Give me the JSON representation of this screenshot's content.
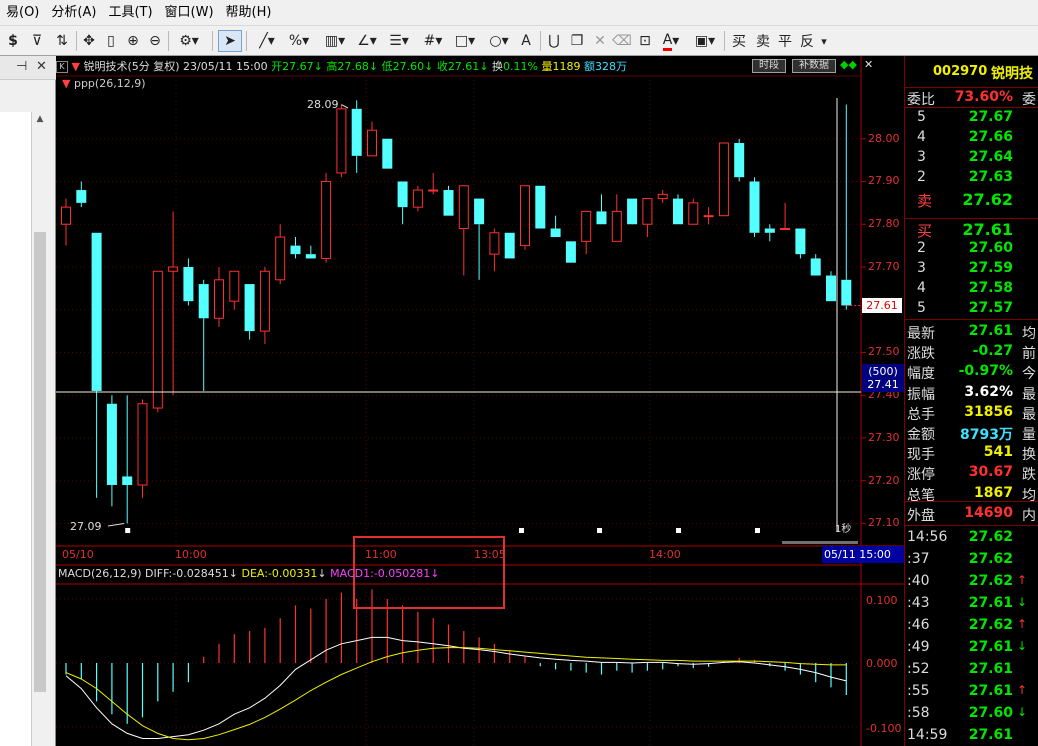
{
  "menu": [
    "易(O)",
    "分析(A)",
    "工具(T)",
    "窗口(W)",
    "帮助(H)"
  ],
  "toolbar": {
    "dollar": "$",
    "buy": "买",
    "sell": "卖",
    "flat": "平",
    "reverse": "反"
  },
  "chart_header": {
    "name": "锐明技术(5分 复权)",
    "datetime": "23/05/11 15:00",
    "open_label": "开",
    "open": "27.67",
    "high_label": "高",
    "high": "27.68",
    "low_label": "低",
    "low": "27.60",
    "close_label": "收",
    "close": "27.61",
    "turnover_label": "换",
    "turnover": "0.11%",
    "volume_label": "量",
    "volume": "1189",
    "amount_label": "额",
    "amount": "328万",
    "btn_timeframe": "时段",
    "btn_supplement": "补数据"
  },
  "indicator_label": "ppp(26,12,9)",
  "annotations": {
    "high": "28.09",
    "low": "27.09",
    "second": "1秒",
    "last_price": "27.61",
    "crosshair_n": "(500)",
    "crosshair_price": "27.41"
  },
  "price_axis": [
    "28.00",
    "27.90",
    "27.80",
    "27.70",
    "27.60",
    "27.50",
    "27.40",
    "27.30",
    "27.20",
    "27.10"
  ],
  "time_axis": [
    "05/10",
    "10:00",
    "11:00",
    "13:05",
    "14:00",
    "05/11 15:00"
  ],
  "macd": {
    "title": "MACD(26,12,9)",
    "diff_label": "DIFF:",
    "diff": "-0.028451",
    "dea_label": "DEA:",
    "dea": "-0.00331",
    "macd1_label": "MACD1:",
    "macd1": "-0.050281",
    "axis": [
      "0.100",
      "0.000",
      "-0.100"
    ]
  },
  "chart_data": {
    "type": "candlestick",
    "ylim": [
      27.08,
      28.1
    ],
    "candles": [
      {
        "o": 27.8,
        "h": 27.86,
        "l": 27.75,
        "c": 27.84
      },
      {
        "o": 27.88,
        "h": 27.9,
        "l": 27.84,
        "c": 27.85
      },
      {
        "o": 27.78,
        "h": 27.78,
        "l": 27.16,
        "c": 27.41
      },
      {
        "o": 27.38,
        "h": 27.4,
        "l": 27.14,
        "c": 27.19
      },
      {
        "o": 27.21,
        "h": 27.4,
        "l": 27.1,
        "c": 27.19
      },
      {
        "o": 27.19,
        "h": 27.39,
        "l": 27.16,
        "c": 27.38
      },
      {
        "o": 27.37,
        "h": 27.69,
        "l": 27.36,
        "c": 27.69
      },
      {
        "o": 27.69,
        "h": 27.83,
        "l": 27.4,
        "c": 27.7
      },
      {
        "o": 27.7,
        "h": 27.72,
        "l": 27.61,
        "c": 27.62
      },
      {
        "o": 27.66,
        "h": 27.67,
        "l": 27.41,
        "c": 27.58
      },
      {
        "o": 27.58,
        "h": 27.7,
        "l": 27.56,
        "c": 27.67
      },
      {
        "o": 27.62,
        "h": 27.69,
        "l": 27.6,
        "c": 27.69
      },
      {
        "o": 27.66,
        "h": 27.66,
        "l": 27.53,
        "c": 27.55
      },
      {
        "o": 27.55,
        "h": 27.7,
        "l": 27.52,
        "c": 27.69
      },
      {
        "o": 27.67,
        "h": 27.8,
        "l": 27.66,
        "c": 27.77
      },
      {
        "o": 27.75,
        "h": 27.77,
        "l": 27.72,
        "c": 27.73
      },
      {
        "o": 27.73,
        "h": 27.75,
        "l": 27.72,
        "c": 27.72
      },
      {
        "o": 27.72,
        "h": 27.92,
        "l": 27.71,
        "c": 27.9
      },
      {
        "o": 27.92,
        "h": 28.08,
        "l": 27.91,
        "c": 28.07
      },
      {
        "o": 28.07,
        "h": 28.09,
        "l": 27.92,
        "c": 27.96
      },
      {
        "o": 27.96,
        "h": 28.04,
        "l": 27.96,
        "c": 28.02
      },
      {
        "o": 28.0,
        "h": 28.0,
        "l": 27.93,
        "c": 27.93
      },
      {
        "o": 27.9,
        "h": 27.9,
        "l": 27.8,
        "c": 27.84
      },
      {
        "o": 27.84,
        "h": 27.89,
        "l": 27.83,
        "c": 27.88
      },
      {
        "o": 27.88,
        "h": 27.92,
        "l": 27.87,
        "c": 27.88
      },
      {
        "o": 27.88,
        "h": 27.89,
        "l": 27.82,
        "c": 27.82
      },
      {
        "o": 27.79,
        "h": 27.89,
        "l": 27.68,
        "c": 27.89
      },
      {
        "o": 27.86,
        "h": 27.86,
        "l": 27.67,
        "c": 27.8
      },
      {
        "o": 27.73,
        "h": 27.79,
        "l": 27.69,
        "c": 27.78
      },
      {
        "o": 27.78,
        "h": 27.78,
        "l": 27.72,
        "c": 27.72
      },
      {
        "o": 27.75,
        "h": 27.89,
        "l": 27.74,
        "c": 27.89
      },
      {
        "o": 27.89,
        "h": 27.89,
        "l": 27.79,
        "c": 27.79
      },
      {
        "o": 27.79,
        "h": 27.82,
        "l": 27.77,
        "c": 27.77
      },
      {
        "o": 27.76,
        "h": 27.76,
        "l": 27.71,
        "c": 27.71
      },
      {
        "o": 27.76,
        "h": 27.83,
        "l": 27.73,
        "c": 27.83
      },
      {
        "o": 27.83,
        "h": 27.87,
        "l": 27.8,
        "c": 27.8
      },
      {
        "o": 27.76,
        "h": 27.87,
        "l": 27.76,
        "c": 27.83
      },
      {
        "o": 27.86,
        "h": 27.86,
        "l": 27.81,
        "c": 27.8
      },
      {
        "o": 27.8,
        "h": 27.86,
        "l": 27.77,
        "c": 27.86
      },
      {
        "o": 27.86,
        "h": 27.88,
        "l": 27.85,
        "c": 27.87
      },
      {
        "o": 27.86,
        "h": 27.87,
        "l": 27.8,
        "c": 27.8
      },
      {
        "o": 27.8,
        "h": 27.86,
        "l": 27.8,
        "c": 27.85
      },
      {
        "o": 27.82,
        "h": 27.84,
        "l": 27.8,
        "c": 27.82
      },
      {
        "o": 27.82,
        "h": 27.99,
        "l": 27.82,
        "c": 27.99
      },
      {
        "o": 27.99,
        "h": 28.0,
        "l": 27.9,
        "c": 27.91
      },
      {
        "o": 27.9,
        "h": 27.91,
        "l": 27.77,
        "c": 27.78
      },
      {
        "o": 27.79,
        "h": 27.8,
        "l": 27.76,
        "c": 27.78
      },
      {
        "o": 27.79,
        "h": 27.85,
        "l": 27.79,
        "c": 27.79
      },
      {
        "o": 27.79,
        "h": 27.79,
        "l": 27.72,
        "c": 27.73
      },
      {
        "o": 27.72,
        "h": 27.73,
        "l": 27.68,
        "c": 27.68
      },
      {
        "o": 27.68,
        "h": 27.69,
        "l": 27.62,
        "c": 27.62
      },
      {
        "o": 27.67,
        "h": 28.08,
        "l": 27.6,
        "c": 27.61
      }
    ],
    "macd_hist": [
      -0.018,
      -0.025,
      -0.06,
      -0.08,
      -0.095,
      -0.085,
      -0.06,
      -0.045,
      -0.03,
      0.01,
      0.03,
      0.045,
      0.05,
      0.055,
      0.07,
      0.09,
      0.085,
      0.1,
      0.11,
      0.1,
      0.115,
      0.1,
      0.09,
      0.08,
      0.07,
      0.06,
      0.05,
      0.04,
      0.03,
      0.02,
      0.01,
      -0.005,
      -0.01,
      -0.012,
      -0.015,
      -0.018,
      -0.012,
      -0.015,
      -0.012,
      -0.01,
      -0.005,
      -0.008,
      -0.006,
      0.003,
      0.008,
      0.005,
      -0.005,
      -0.012,
      -0.018,
      -0.03,
      -0.038,
      -0.05
    ],
    "diff": [
      -0.02,
      -0.04,
      -0.07,
      -0.095,
      -0.11,
      -0.118,
      -0.118,
      -0.115,
      -0.112,
      -0.105,
      -0.095,
      -0.08,
      -0.07,
      -0.055,
      -0.035,
      -0.01,
      0.005,
      0.02,
      0.03,
      0.035,
      0.04,
      0.04,
      0.035,
      0.033,
      0.03,
      0.027,
      0.023,
      0.021,
      0.018,
      0.014,
      0.011,
      0.008,
      0.006,
      0.004,
      0.003,
      0.001,
      0.001,
      0.0,
      0.001,
      0.001,
      -0.001,
      -0.002,
      -0.001,
      0.001,
      0.002,
      0.0,
      -0.003,
      -0.006,
      -0.01,
      -0.015,
      -0.022,
      -0.028
    ],
    "dea": [
      -0.015,
      -0.025,
      -0.04,
      -0.06,
      -0.08,
      -0.098,
      -0.11,
      -0.118,
      -0.12,
      -0.118,
      -0.112,
      -0.104,
      -0.096,
      -0.085,
      -0.072,
      -0.058,
      -0.043,
      -0.03,
      -0.018,
      -0.008,
      0.002,
      0.01,
      0.016,
      0.02,
      0.023,
      0.024,
      0.024,
      0.023,
      0.021,
      0.019,
      0.017,
      0.015,
      0.013,
      0.011,
      0.009,
      0.008,
      0.007,
      0.006,
      0.005,
      0.004,
      0.004,
      0.003,
      0.003,
      0.003,
      0.003,
      0.003,
      0.002,
      0.001,
      -0.001,
      -0.002,
      -0.003,
      -0.003
    ],
    "macd_ylim": [
      -0.13,
      0.13
    ]
  },
  "quote": {
    "code": "002970",
    "name": "锐明技",
    "webi_label": "委比",
    "webi": "73.60%",
    "wei_ext": "委",
    "sell": [
      {
        "n": "5",
        "price": "27.67"
      },
      {
        "n": "4",
        "price": "27.66"
      },
      {
        "n": "3",
        "price": "27.64"
      },
      {
        "n": "2",
        "price": "27.63"
      },
      {
        "n": "卖",
        "price": "27.62"
      }
    ],
    "buy": [
      {
        "n": "买",
        "price": "27.61"
      },
      {
        "n": "2",
        "price": "27.60"
      },
      {
        "n": "3",
        "price": "27.59"
      },
      {
        "n": "4",
        "price": "27.58"
      },
      {
        "n": "5",
        "price": "27.57"
      }
    ],
    "stats": [
      {
        "label": "最新",
        "value": "27.61",
        "ext": "均",
        "color": "green"
      },
      {
        "label": "涨跌",
        "value": "-0.27",
        "ext": "前",
        "color": "green"
      },
      {
        "label": "幅度",
        "value": "-0.97%",
        "ext": "今",
        "color": "green"
      },
      {
        "label": "振幅",
        "value": "3.62%",
        "ext": "最",
        "color": "white"
      },
      {
        "label": "总手",
        "value": "31856",
        "ext": "最",
        "color": "yellow"
      },
      {
        "label": "金额",
        "value": "8793万",
        "ext": "量",
        "color": "cyan"
      },
      {
        "label": "现手",
        "value": "541",
        "ext": "换",
        "color": "yellow"
      },
      {
        "label": "涨停",
        "value": "30.67",
        "ext": "跌",
        "color": "red"
      },
      {
        "label": "总笔",
        "value": "1867",
        "ext": "均",
        "color": "yellow"
      }
    ],
    "outer_label": "外盘",
    "outer": "14690",
    "inner_ext": "内",
    "ticks": [
      {
        "time": "14:56",
        "price": "27.62",
        "arrow": ""
      },
      {
        "time": ":37",
        "price": "27.62",
        "arrow": ""
      },
      {
        "time": ":40",
        "price": "27.62",
        "arrow": "↑"
      },
      {
        "time": ":43",
        "price": "27.61",
        "arrow": "↓"
      },
      {
        "time": ":46",
        "price": "27.62",
        "arrow": "↑"
      },
      {
        "time": ":49",
        "price": "27.61",
        "arrow": "↓"
      },
      {
        "time": ":52",
        "price": "27.61",
        "arrow": ""
      },
      {
        "time": ":55",
        "price": "27.61",
        "arrow": "↑"
      },
      {
        "time": ":58",
        "price": "27.60",
        "arrow": "↓"
      },
      {
        "time": "14:59",
        "price": "27.61",
        "arrow": ""
      }
    ]
  }
}
